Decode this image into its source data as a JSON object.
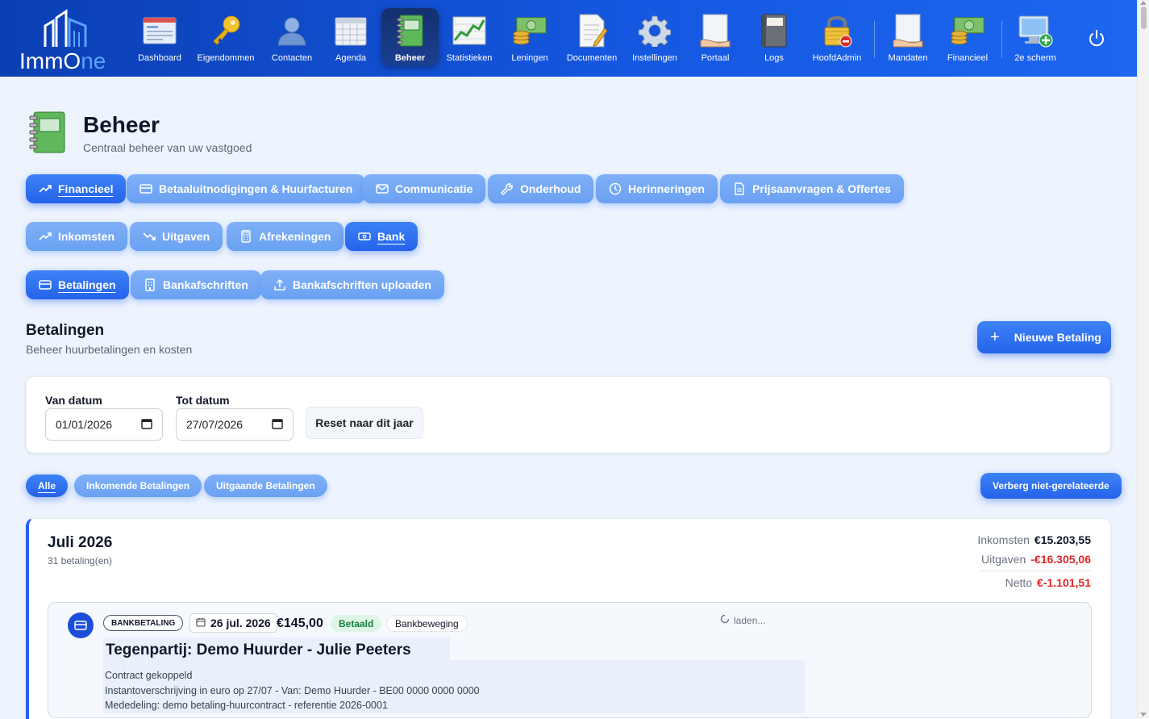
{
  "app": {
    "logo_text_a": "ImmO",
    "logo_text_b": "ne"
  },
  "nav": [
    {
      "label": "Dashboard",
      "icon": "dashboard-icon"
    },
    {
      "label": "Eigendommen",
      "icon": "key-icon"
    },
    {
      "label": "Contacten",
      "icon": "contact-icon"
    },
    {
      "label": "Agenda",
      "icon": "calendar-icon"
    },
    {
      "label": "Beheer",
      "icon": "notebook-icon",
      "active": true
    },
    {
      "label": "Statistieken",
      "icon": "chart-icon"
    },
    {
      "label": "Leningen",
      "icon": "money-icon"
    },
    {
      "label": "Documenten",
      "icon": "document-icon"
    },
    {
      "label": "Instellingen",
      "icon": "gear-icon"
    },
    {
      "label": "Portaal",
      "icon": "portal-icon"
    },
    {
      "label": "Logs",
      "icon": "book-icon"
    },
    {
      "label": "HoofdAdmin",
      "icon": "lock-icon"
    },
    {
      "label": "Mandaten",
      "icon": "mandate-icon"
    },
    {
      "label": "Financieel",
      "icon": "coins-icon"
    },
    {
      "label": "2e scherm",
      "icon": "monitor-plus-icon"
    }
  ],
  "page": {
    "title": "Beheer",
    "subtitle": "Centraal beheer van uw vastgoed"
  },
  "tabs_main": [
    {
      "label": "Financieel",
      "active": true
    },
    {
      "label": "Betaaluitnodigingen & Huurfacturen"
    },
    {
      "label": "Communicatie"
    },
    {
      "label": "Onderhoud"
    },
    {
      "label": "Herinneringen"
    },
    {
      "label": "Prijsaanvragen & Offertes"
    }
  ],
  "tabs_fin": [
    {
      "label": "Inkomsten"
    },
    {
      "label": "Uitgaven"
    },
    {
      "label": "Afrekeningen"
    },
    {
      "label": "Bank",
      "active": true
    }
  ],
  "tabs_bank": [
    {
      "label": "Betalingen",
      "active": true
    },
    {
      "label": "Bankafschriften"
    },
    {
      "label": "Bankafschriften uploaden"
    }
  ],
  "section": {
    "title": "Betalingen",
    "subtitle": "Beheer huurbetalingen en kosten",
    "new_button": "Nieuwe Betaling"
  },
  "filter": {
    "from_label": "Van datum",
    "from_value": "01/01/2026",
    "to_label": "Tot datum",
    "to_value": "27/07/2026",
    "reset_label": "Reset naar dit jaar"
  },
  "type_filters": [
    {
      "label": "Alle",
      "active": true
    },
    {
      "label": "Inkomende Betalingen"
    },
    {
      "label": "Uitgaande Betalingen"
    }
  ],
  "hide_button": "Verberg niet-gerelateerde",
  "month": {
    "title": "Juli 2026",
    "count": "31 betaling(en)",
    "income_label": "Inkomsten",
    "income_value": "€15.203,55",
    "expense_label": "Uitgaven",
    "expense_value": "-€16.305,06",
    "net_label": "Netto",
    "net_value": "€-1.101,51"
  },
  "payment": {
    "type_tag": "BANKBETALING",
    "date": "26 jul. 2026",
    "amount": "€145,00",
    "status": "Betaald",
    "source": "Bankbeweging",
    "loading": "laden...",
    "counterparty": "Tegenpartij: Demo Huurder - Julie Peeters",
    "line1": "Contract gekoppeld",
    "line2": "Instantoverschrijving in euro op 27/07 - Van: Demo Huurder - BE00 0000 0000 0000",
    "line3": "Mededeling: demo betaling-huurcontract - referentie 2026-0001"
  },
  "colors": {
    "accent": "#2563eb",
    "pill_light": "#6aa1f2",
    "negative": "#dc2626",
    "paid_bg": "#dff5e6",
    "paid_text": "#15803d"
  }
}
